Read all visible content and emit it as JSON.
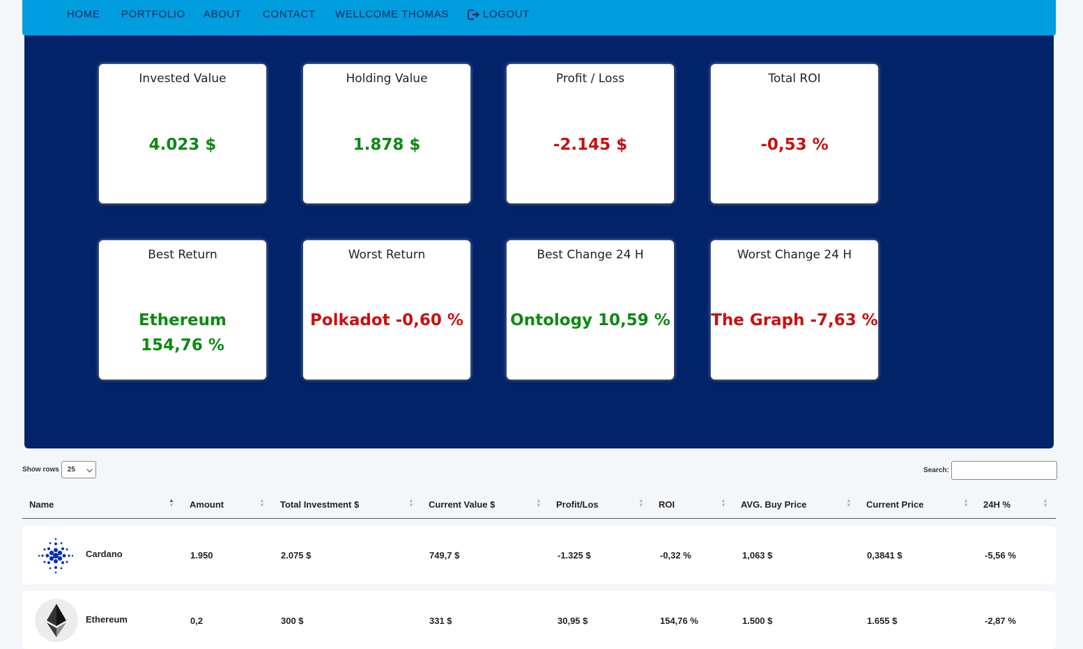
{
  "nav": {
    "items": [
      "HOME",
      "PORTFOLIO",
      "ABOUT",
      "CONTACT",
      "WELLCOME THOMAS"
    ],
    "logout": "LOGOUT"
  },
  "cards": [
    {
      "title": "Invested Value",
      "value": "4.023 $",
      "color": "green"
    },
    {
      "title": "Holding Value",
      "value": "1.878 $",
      "color": "green"
    },
    {
      "title": "Profit / Loss",
      "value": "-2.145 $",
      "color": "red"
    },
    {
      "title": "Total ROI",
      "value": "-0,53 %",
      "color": "red"
    },
    {
      "title": "Best Return",
      "value_line1": "Ethereum",
      "value_line2": "154,76 %",
      "color": "green"
    },
    {
      "title": "Worst Return",
      "value": "Polkadot -0,60 %",
      "color": "red"
    },
    {
      "title": "Best Change 24 H",
      "value": "Ontology 10,59 %",
      "color": "green"
    },
    {
      "title": "Worst Change 24 H",
      "value": "The Graph -7,63 %",
      "color": "red"
    }
  ],
  "table": {
    "show_rows_label": "Show rows",
    "rows_value": "25",
    "search_label": "Search:",
    "columns": [
      "Name",
      "Amount",
      "Total Investment $",
      "Current Value $",
      "Profit/Los",
      "ROI",
      "AVG. Buy Price",
      "Current Price",
      "24H %"
    ],
    "rows": [
      {
        "name": "Cardano",
        "icon": "cardano-logo",
        "amount": "1.950",
        "investment": "2.075 $",
        "current_value": "749,7 $",
        "profit": "-1.325 $",
        "roi": "-0,32 %",
        "avg_buy": "1,063 $",
        "current_price": "0,3841 $",
        "change_24h": "-5,56 %",
        "profit_color": "red",
        "roi_color": "red",
        "change_color": "red"
      },
      {
        "name": "Ethereum",
        "icon": "ethereum-logo",
        "amount": "0,2",
        "investment": "300 $",
        "current_value": "331 $",
        "profit": "30,95 $",
        "roi": "154,76 %",
        "avg_buy": "1.500 $",
        "current_price": "1.655 $",
        "change_24h": "-2,87 %",
        "profit_color": "green",
        "roi_color": "green",
        "change_color": "red"
      }
    ]
  },
  "colors": {
    "nav": "#009ddf",
    "panel": "#02236a",
    "green": "#0d8a12",
    "red": "#cc0f0f"
  }
}
